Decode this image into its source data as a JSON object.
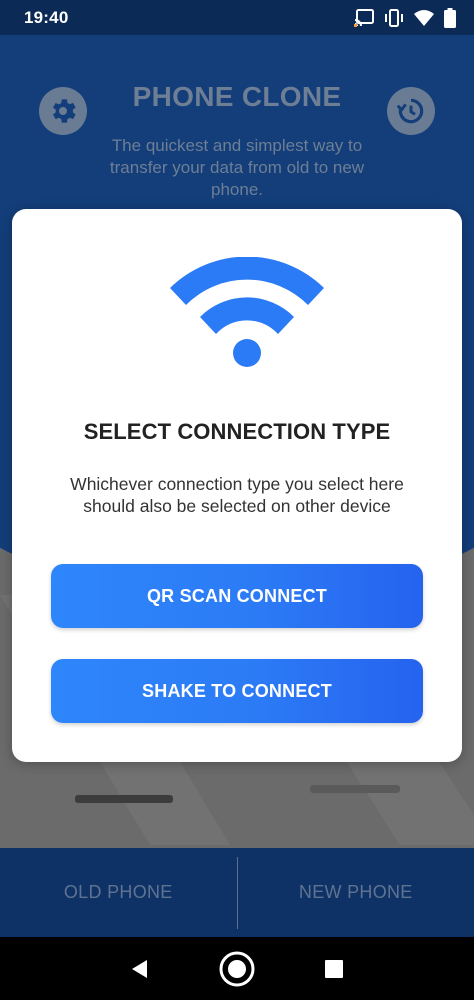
{
  "status_bar": {
    "time": "19:40",
    "icons": [
      "cast-icon",
      "vibrate-icon",
      "wifi-signal-icon",
      "battery-icon"
    ]
  },
  "background_app": {
    "title": "PHONE CLONE",
    "subtitle": "The quickest and simplest way to transfer your data from old to new phone.",
    "icons": [
      "settings-icon",
      "history-icon"
    ],
    "tabs": [
      {
        "label": "OLD PHONE"
      },
      {
        "label": "NEW PHONE"
      }
    ]
  },
  "dialog": {
    "icon": "wifi-icon",
    "title": "SELECT CONNECTION TYPE",
    "description": "Whichever connection type you select here should also be selected on other device",
    "buttons": {
      "qr_scan": "QR SCAN CONNECT",
      "shake": "SHAKE TO CONNECT"
    }
  },
  "nav_bar": {
    "buttons": [
      "back-icon",
      "home-icon",
      "recents-icon"
    ]
  },
  "colors": {
    "primary_blue": "#2c7bf6",
    "header_blue": "#133e7a",
    "status_bar": "#0b2a55",
    "tab_bar": "#0f3266"
  }
}
